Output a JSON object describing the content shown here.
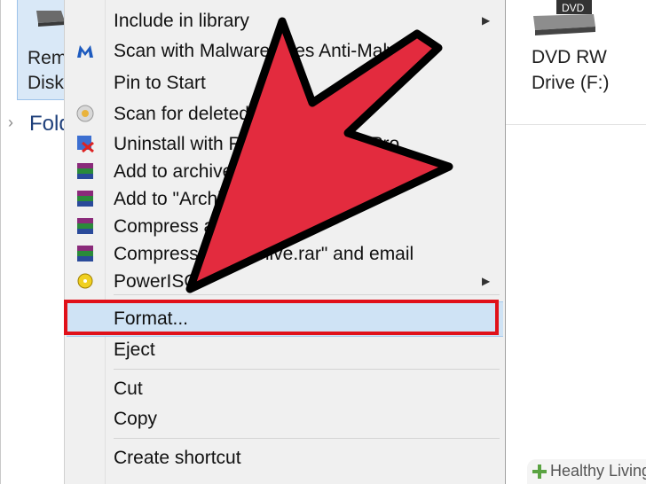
{
  "explorer": {
    "left_drive_label_line1": "Removable",
    "left_drive_label_line2": "Disk",
    "folders_label": "Folders",
    "dvd_drive_label_line1": "DVD RW",
    "dvd_drive_label_line2": "Drive (F:)",
    "dvd_icon_text": "DVD"
  },
  "context_menu": {
    "items": [
      {
        "label": "Include in library",
        "icon": "none",
        "submenu": true
      },
      {
        "label": "Scan with Malwarebytes Anti-Malware",
        "icon": "malwarebytes-icon",
        "submenu": false
      },
      {
        "label": "Pin to Start",
        "icon": "none",
        "submenu": false
      },
      {
        "label": "Scan for deleted files",
        "icon": "recovery-scan-icon",
        "submenu": false
      },
      {
        "label": "Uninstall with Revo Uninstaller Pro",
        "icon": "revo-uninstaller-icon",
        "submenu": false
      },
      {
        "label": "Add to archive...",
        "icon": "winrar-icon",
        "submenu": false
      },
      {
        "label": "Add to \"Archive.rar\"",
        "icon": "winrar-icon",
        "submenu": false
      },
      {
        "label": "Compress and email...",
        "icon": "winrar-icon",
        "submenu": false
      },
      {
        "label": "Compress to \"Archive.rar\" and email",
        "icon": "winrar-icon",
        "submenu": false
      },
      {
        "label": "PowerISO",
        "icon": "poweriso-icon",
        "submenu": true
      },
      {
        "label": "Format...",
        "icon": "none",
        "submenu": false,
        "highlighted": true
      },
      {
        "label": "Eject",
        "icon": "none",
        "submenu": false
      },
      {
        "label": "Cut",
        "icon": "none",
        "submenu": false
      },
      {
        "label": "Copy",
        "icon": "none",
        "submenu": false
      },
      {
        "label": "Create shortcut",
        "icon": "none",
        "submenu": false
      }
    ]
  },
  "annotation": {
    "arrow_color": "#e32b3e",
    "box_color": "#e0111a"
  },
  "watermark": {
    "text": "Healthy Living"
  }
}
